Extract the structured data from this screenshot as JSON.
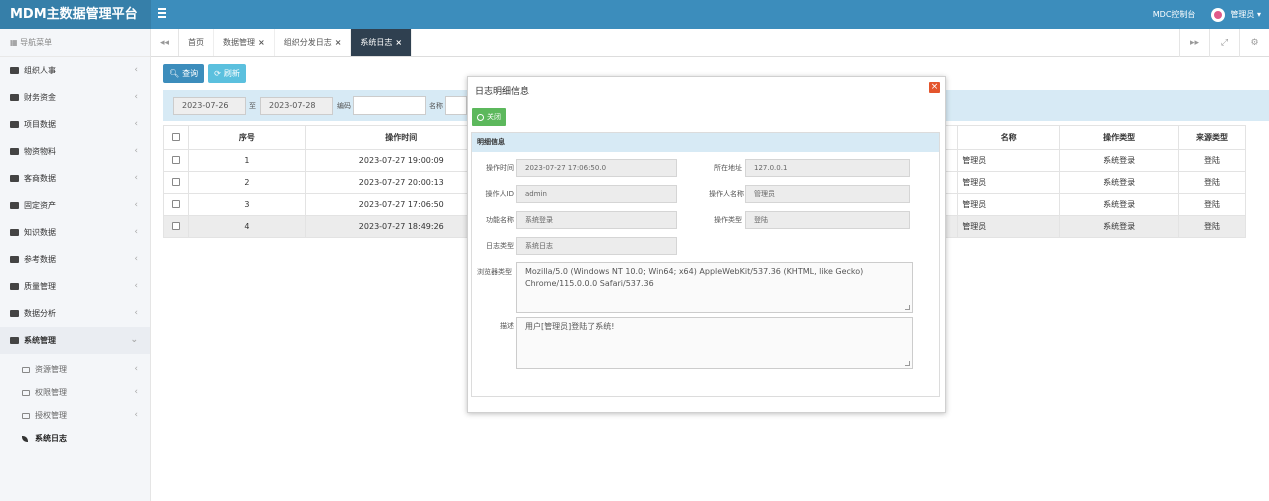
{
  "header": {
    "logo": "MDM主数据管理平台",
    "console_link": "MDC控制台",
    "user": "管理员"
  },
  "sidebar": {
    "title": "导航菜单",
    "items": [
      {
        "label": "组织人事"
      },
      {
        "label": "财务资金"
      },
      {
        "label": "项目数据"
      },
      {
        "label": "物资物料"
      },
      {
        "label": "客商数据"
      },
      {
        "label": "固定资产"
      },
      {
        "label": "知识数据"
      },
      {
        "label": "参考数据"
      },
      {
        "label": "质量管理"
      },
      {
        "label": "数据分析"
      },
      {
        "label": "系统管理"
      }
    ],
    "sub_items": [
      {
        "label": "资源管理"
      },
      {
        "label": "权限管理"
      },
      {
        "label": "授权管理"
      },
      {
        "label": "系统日志"
      }
    ]
  },
  "tabs": [
    {
      "label": "首页"
    },
    {
      "label": "数据管理"
    },
    {
      "label": "组织分发日志"
    },
    {
      "label": "系统日志"
    }
  ],
  "toolbar": {
    "query": "查询",
    "refresh": "刷新"
  },
  "search": {
    "date_from": "2023-07-26",
    "to_label": "至",
    "date_to": "2023-07-28",
    "code_label": "编码",
    "name_label": "名称"
  },
  "grid": {
    "headers": {
      "seq": "序号",
      "time": "操作时间",
      "name": "名称",
      "op_type": "操作类型",
      "source_type": "来源类型"
    },
    "rows": [
      {
        "seq": "1",
        "time": "2023-07-27 19:00:09",
        "name": "管理员",
        "op_type": "系统登录",
        "source_type": "登陆"
      },
      {
        "seq": "2",
        "time": "2023-07-27 20:00:13",
        "name": "管理员",
        "op_type": "系统登录",
        "source_type": "登陆"
      },
      {
        "seq": "3",
        "time": "2023-07-27 17:06:50",
        "name": "管理员",
        "op_type": "系统登录",
        "source_type": "登陆"
      },
      {
        "seq": "4",
        "time": "2023-07-27 18:49:26",
        "name": "管理员",
        "op_type": "系统登录",
        "source_type": "登陆"
      }
    ]
  },
  "modal": {
    "title": "日志明细信息",
    "close_button": "关闭",
    "section_title": "明细信息",
    "fields": {
      "op_time_label": "操作时间",
      "op_time": "2023-07-27 17:06:50.0",
      "address_label": "所在地址",
      "address": "127.0.0.1",
      "operator_id_label": "操作人ID",
      "operator_id": "admin",
      "operator_name_label": "操作人名称",
      "operator_name": "管理员",
      "func_name_label": "功能名称",
      "func_name": "系统登录",
      "op_type_label": "操作类型",
      "op_type": "登陆",
      "log_type_label": "日志类型",
      "log_type": "系统日志",
      "browser_label": "浏览器类型",
      "browser": "Mozilla/5.0 (Windows NT 10.0; Win64; x64) AppleWebKit/537.36 (KHTML, like Gecko) Chrome/115.0.0.0 Safari/537.36",
      "desc_label": "描述",
      "desc": "用户[管理员]登陆了系统!"
    }
  }
}
